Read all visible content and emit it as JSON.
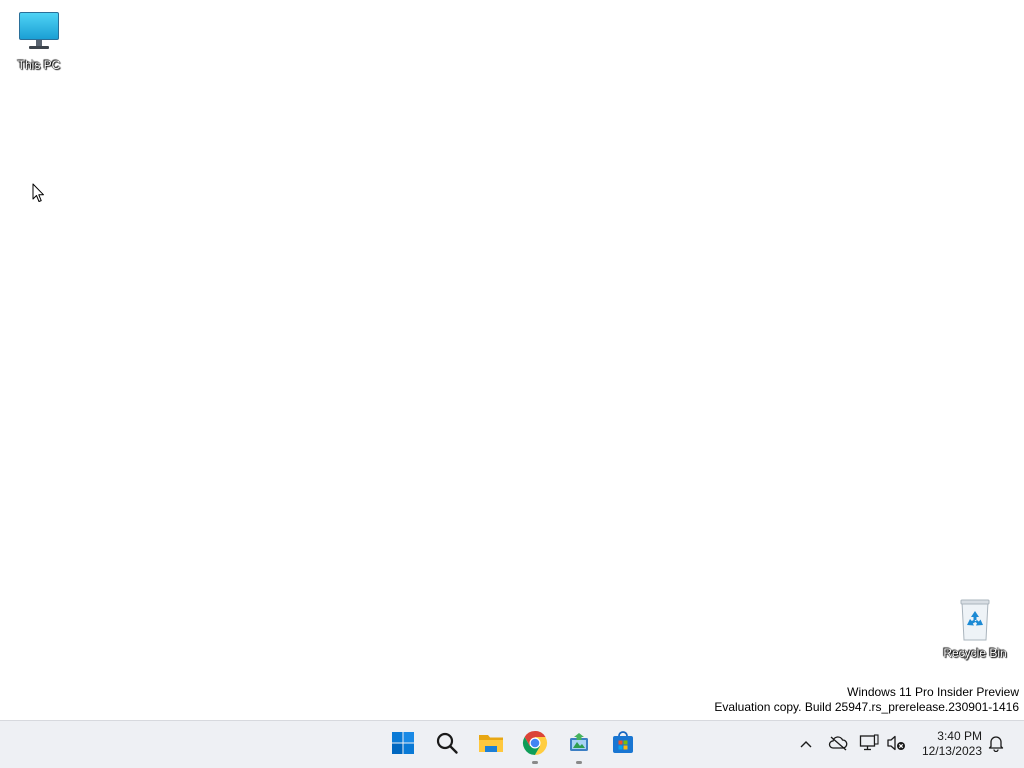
{
  "desktop": {
    "icons": [
      {
        "label": "This PC",
        "icon": "monitor-icon"
      },
      {
        "label": "Recycle Bin",
        "icon": "recycle-bin-icon"
      }
    ],
    "background_color": "#ffffff"
  },
  "watermark": {
    "line1": "Windows 11 Pro Insider Preview",
    "line2": "Evaluation copy. Build 25947.rs_prerelease.230901-1416"
  },
  "taskbar": {
    "apps": [
      {
        "name": "Start",
        "icon": "windows-start-icon",
        "running": false
      },
      {
        "name": "Search",
        "icon": "search-icon",
        "running": false
      },
      {
        "name": "File Explorer",
        "icon": "folder-icon",
        "running": false
      },
      {
        "name": "Google Chrome",
        "icon": "chrome-icon",
        "running": true
      },
      {
        "name": "App",
        "icon": "app-icon",
        "running": true
      },
      {
        "name": "Microsoft Store",
        "icon": "store-icon",
        "running": false
      }
    ],
    "tray": {
      "icons": [
        "chevron-up-icon",
        "onedrive-offline-icon",
        "network-icon",
        "volume-muted-icon",
        "notification-bell-icon"
      ],
      "time": "3:40 PM",
      "date": "12/13/2023"
    },
    "colors": {
      "background": "#eef0f4",
      "accent": "#0078d4"
    }
  }
}
